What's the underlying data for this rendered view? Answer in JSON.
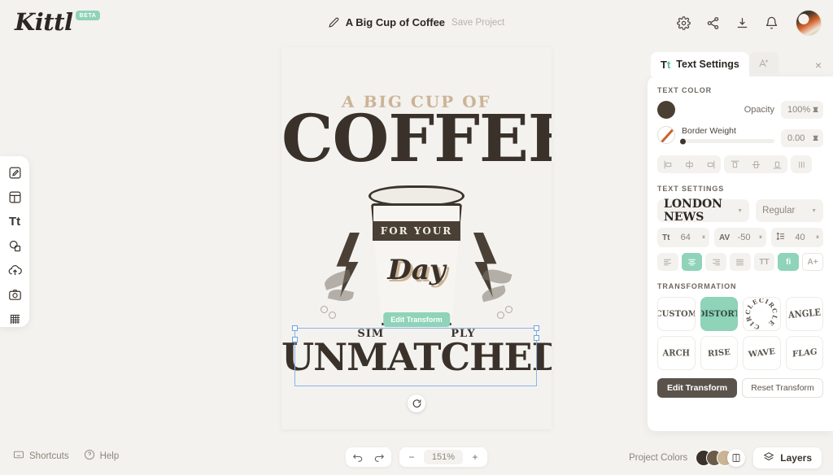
{
  "app": {
    "logo": "Kittl",
    "logo_badge": "BETA",
    "accent_green": "#8fd3b8",
    "bg": "#f4f2ee"
  },
  "header": {
    "project_title": "A Big Cup of Coffee",
    "save_label": "Save Project",
    "pencil_icon": "pencil-icon",
    "actions": [
      {
        "name": "settings-icon",
        "label": "Settings"
      },
      {
        "name": "share-icon",
        "label": "Share"
      },
      {
        "name": "download-icon",
        "label": "Download"
      },
      {
        "name": "notifications-icon",
        "label": "Notifications"
      }
    ],
    "avatar_label": "User Avatar"
  },
  "left_rail": {
    "items": [
      {
        "name": "edit-tool",
        "label": "Edit"
      },
      {
        "name": "templates-tool",
        "label": "Templates"
      },
      {
        "name": "text-tool",
        "label": "Text",
        "glyph": "Tt"
      },
      {
        "name": "elements-tool",
        "label": "Elements"
      },
      {
        "name": "uploads-tool",
        "label": "Uploads"
      },
      {
        "name": "photos-tool",
        "label": "Photos"
      },
      {
        "name": "patterns-tool",
        "label": "Patterns"
      }
    ]
  },
  "canvas": {
    "artwork": {
      "line_top": "A BIG CUP OF",
      "line_headline": "COFFEE",
      "cup_band": "FOR YOUR",
      "cup_word": "Day",
      "line_sim": "SIM",
      "line_ply": "PLY",
      "line_bottom": "UNMATCHED"
    },
    "selection_tooltip": "Edit Transform",
    "rotate_handle": "rotate-handle"
  },
  "panel": {
    "tab_active": "Text Settings",
    "tab_active_icon": "Tt",
    "tab_secondary_icon": "add-text-effect-icon",
    "close_label": "×",
    "text_color": {
      "section": "TEXT COLOR",
      "fill_color": "#4a3f33",
      "opacity_label": "Opacity",
      "opacity_value": "100%",
      "border_weight_label": "Border Weight",
      "border_weight_value": "0.00"
    },
    "align_icons": [
      {
        "name": "align-left-icon"
      },
      {
        "name": "align-center-horizontal-icon"
      },
      {
        "name": "align-right-icon"
      },
      {
        "name": "align-top-icon"
      },
      {
        "name": "align-middle-vertical-icon"
      },
      {
        "name": "align-bottom-icon"
      },
      {
        "name": "distribute-icon"
      }
    ],
    "text_settings": {
      "section": "TEXT SETTINGS",
      "font_family": "LONDON NEWS",
      "font_style": "Regular",
      "font_size_icon": "Tt",
      "font_size": "64",
      "letter_spacing_icon": "AV",
      "letter_spacing": "-50",
      "line_height_icon": "line-height-icon",
      "line_height": "40",
      "style_buttons": [
        {
          "name": "text-align-left-icon",
          "label": "",
          "active": false
        },
        {
          "name": "text-align-center-icon",
          "label": "",
          "active": true
        },
        {
          "name": "text-align-right-icon",
          "label": "",
          "active": false
        },
        {
          "name": "text-align-justify-icon",
          "label": "",
          "active": false
        },
        {
          "name": "uppercase-icon",
          "label": "TT",
          "active": false
        },
        {
          "name": "ligature-icon",
          "label": "fi",
          "active": true
        },
        {
          "name": "add-font-icon",
          "label": "A+",
          "active": false
        }
      ]
    },
    "transformation": {
      "section": "TRANSFORMATION",
      "options": [
        {
          "name": "transform-custom",
          "label": "CUSTOM",
          "active": false
        },
        {
          "name": "transform-distort",
          "label": "DISTORT",
          "active": true
        },
        {
          "name": "transform-circle",
          "label": "CIRCLE",
          "active": false
        },
        {
          "name": "transform-angle",
          "label": "ANGLE",
          "active": false
        },
        {
          "name": "transform-arch",
          "label": "ARCH",
          "active": false
        },
        {
          "name": "transform-rise",
          "label": "RISE",
          "active": false
        },
        {
          "name": "transform-wave",
          "label": "WAVE",
          "active": false
        },
        {
          "name": "transform-flag",
          "label": "FLAG",
          "active": false
        }
      ],
      "edit_button": "Edit Transform",
      "reset_button": "Reset Transform"
    }
  },
  "footer": {
    "shortcuts": "Shortcuts",
    "help": "Help",
    "undo_icon": "undo-icon",
    "redo_icon": "redo-icon",
    "zoom_out": "−",
    "zoom_value": "151%",
    "zoom_in": "+",
    "project_colors_label": "Project Colors",
    "project_colors": [
      "#3a322a",
      "#6b5c4a",
      "#cbb395"
    ],
    "layers_label": "Layers"
  }
}
